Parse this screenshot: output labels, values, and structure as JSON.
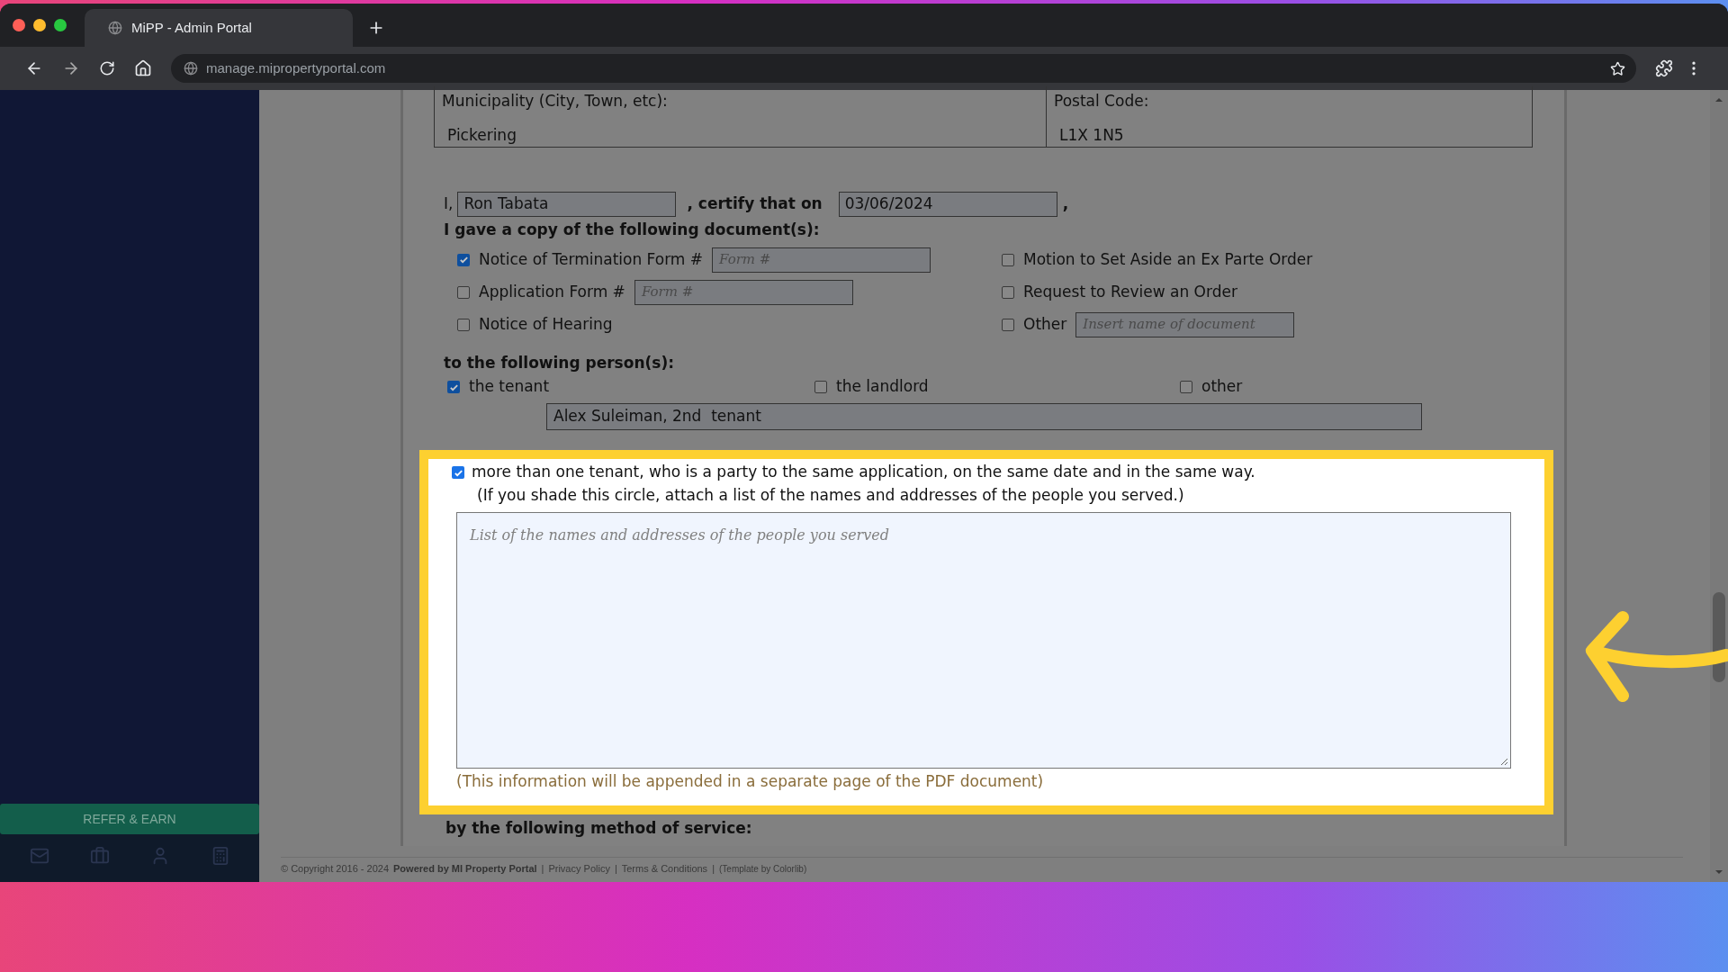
{
  "browser": {
    "tab_title": "MiPP - Admin Portal",
    "url": "manage.mipropertyportal.com"
  },
  "sidebar": {
    "refer_button": "REFER & EARN"
  },
  "address": {
    "municipality_label": "Municipality (City, Town, etc):",
    "municipality": "Pickering",
    "postal_label": "Postal Code:",
    "postal": "L1X 1N5"
  },
  "certify": {
    "prefix": "I,",
    "name": "Ron Tabata",
    "middle": ", certify that on",
    "date": "03/06/2024",
    "suffix": ","
  },
  "documents_heading": "I gave a copy of the following document(s):",
  "documents_left": [
    {
      "kind": "field",
      "label": "Notice of Termination Form #",
      "checked": true,
      "placeholder": "Form #"
    },
    {
      "kind": "field",
      "label": "Application Form #",
      "checked": false,
      "placeholder": "Form #"
    },
    {
      "kind": "plain",
      "label": "Notice of Hearing",
      "checked": false
    }
  ],
  "documents_right": [
    {
      "kind": "plain",
      "label": "Motion to Set Aside an Ex Parte Order",
      "checked": false
    },
    {
      "kind": "plain",
      "label": "Request to Review an Order",
      "checked": false
    },
    {
      "kind": "field",
      "label": "Other",
      "checked": false,
      "placeholder": "Insert name of document"
    }
  ],
  "persons_heading": "to the following person(s):",
  "persons": [
    {
      "label": "the tenant",
      "checked": true
    },
    {
      "label": "the landlord",
      "checked": false
    },
    {
      "label": "other",
      "checked": false
    }
  ],
  "person_name": "Alex Suleiman, 2nd  tenant",
  "multiple": {
    "checked": true,
    "text": "more than one tenant, who is a party to the same application, on the same date and in the same way.",
    "note": "(If you shade this circle, attach a list of the names and addresses of the people you served.)",
    "placeholder": "List of the names and addresses of the people you served",
    "info": "(This information will be appended in a separate page of the PDF document)"
  },
  "method_heading": "by the following method of service:",
  "footer": {
    "copyright": "© Copyright 2016 - 2024",
    "powered": "Powered by MI Property Portal",
    "separator": "|",
    "links": [
      "Privacy Policy",
      "Terms & Conditions"
    ],
    "template": "(Template by Colorlib)"
  }
}
